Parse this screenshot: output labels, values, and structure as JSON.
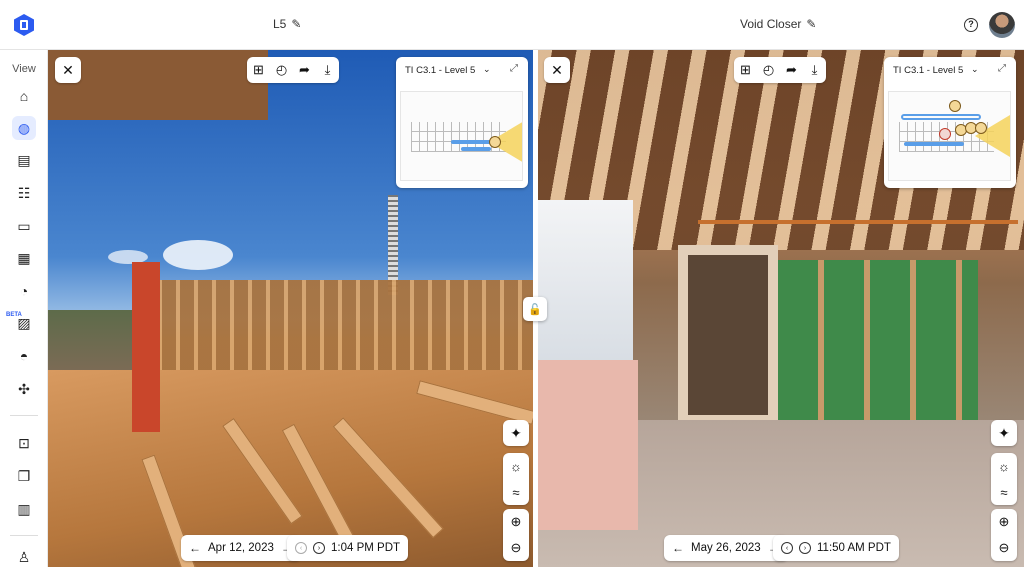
{
  "header": {
    "left_title": "L5",
    "right_title": "Void Closer",
    "help_label": "?"
  },
  "sidebar": {
    "view_label": "View",
    "beta_label": "BETA",
    "items": [
      {
        "name": "home-icon",
        "glyph": "⌂"
      },
      {
        "name": "globe-icon",
        "glyph": "◍"
      },
      {
        "name": "map-icon",
        "glyph": "▤"
      },
      {
        "name": "checklist-icon",
        "glyph": "☷"
      },
      {
        "name": "clipboard-icon",
        "glyph": "▭"
      },
      {
        "name": "document-icon",
        "glyph": "▦"
      },
      {
        "name": "timelapse-icon",
        "glyph": "◔"
      },
      {
        "name": "image-icon",
        "glyph": "▨"
      },
      {
        "name": "hardhat-icon",
        "glyph": "◓"
      },
      {
        "name": "drone-icon",
        "glyph": "✣"
      },
      {
        "name": "scan-icon",
        "glyph": "⊡"
      },
      {
        "name": "folders-icon",
        "glyph": "❐"
      },
      {
        "name": "report-icon",
        "glyph": "▥"
      },
      {
        "name": "robot-icon",
        "glyph": "♙"
      }
    ]
  },
  "panes": [
    {
      "minimap_title": "TI C3.1 - Level 5",
      "date": "Apr 12, 2023",
      "time": "1:04 PM PDT"
    },
    {
      "minimap_title": "TI C3.1 - Level 5",
      "date": "May 26, 2023",
      "time": "11:50 AM PDT"
    }
  ],
  "icons": {
    "close": "✕",
    "add_capture": "⊞",
    "timelapse": "◴",
    "share": "➦",
    "download": "⤓",
    "chevron": "⌄",
    "expand": "⤢",
    "magic": "✦",
    "brightness": "☼",
    "adjust": "≈",
    "zoom_in": "⊕",
    "zoom_out": "⊖",
    "arrow_left": "←",
    "arrow_right": "→",
    "prev": "‹",
    "next": "›",
    "lock": "🔓",
    "pencil": "✎"
  },
  "colors": {
    "brand": "#2c5bf0",
    "path": "#5a9ee8",
    "cone": "#f4d25a"
  }
}
